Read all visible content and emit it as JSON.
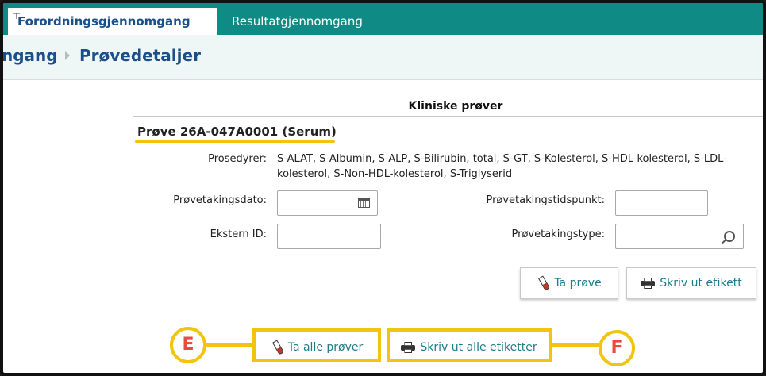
{
  "tabs": [
    {
      "label": "Forordningsgjennomgang",
      "active": true
    },
    {
      "label": "Resultatgjennomgang",
      "active": false
    }
  ],
  "pin_glyph": "⊤",
  "breadcrumb": [
    "ngang",
    "Prøvedetaljer"
  ],
  "section_title": "Kliniske prøver",
  "sample": {
    "title": "Prøve 26A-047A0001 (Serum)",
    "procedures_label": "Prosedyrer:",
    "procedures_line1": "S-ALAT, S-Albumin, S-ALP, S-Bilirubin, total, S-GT, S-Kolesterol, S-HDL-kolesterol, S-LDL-",
    "procedures_line2": "kolesterol, S-Non-HDL-kolesterol, S-Triglyserid",
    "fields": {
      "sampling_date_label": "Prøvetakingsdato:",
      "sampling_time_label": "Prøvetakingstidspunkt:",
      "external_id_label": "Ekstern ID:",
      "sampling_type_label": "Prøvetakingstype:"
    },
    "take_sample_label": "Ta prøve",
    "print_label_label": "Skriv ut etikett"
  },
  "bottom": {
    "take_all_label": "Ta alle prøver",
    "print_all_label": "Skriv ut alle etiketter"
  },
  "annotations": {
    "left": "E",
    "right": "F"
  },
  "colors": {
    "teal": "#0f8a84",
    "navy": "#1b4f8a",
    "highlight": "#f1c40f",
    "annotation_text": "#e74c3c"
  }
}
